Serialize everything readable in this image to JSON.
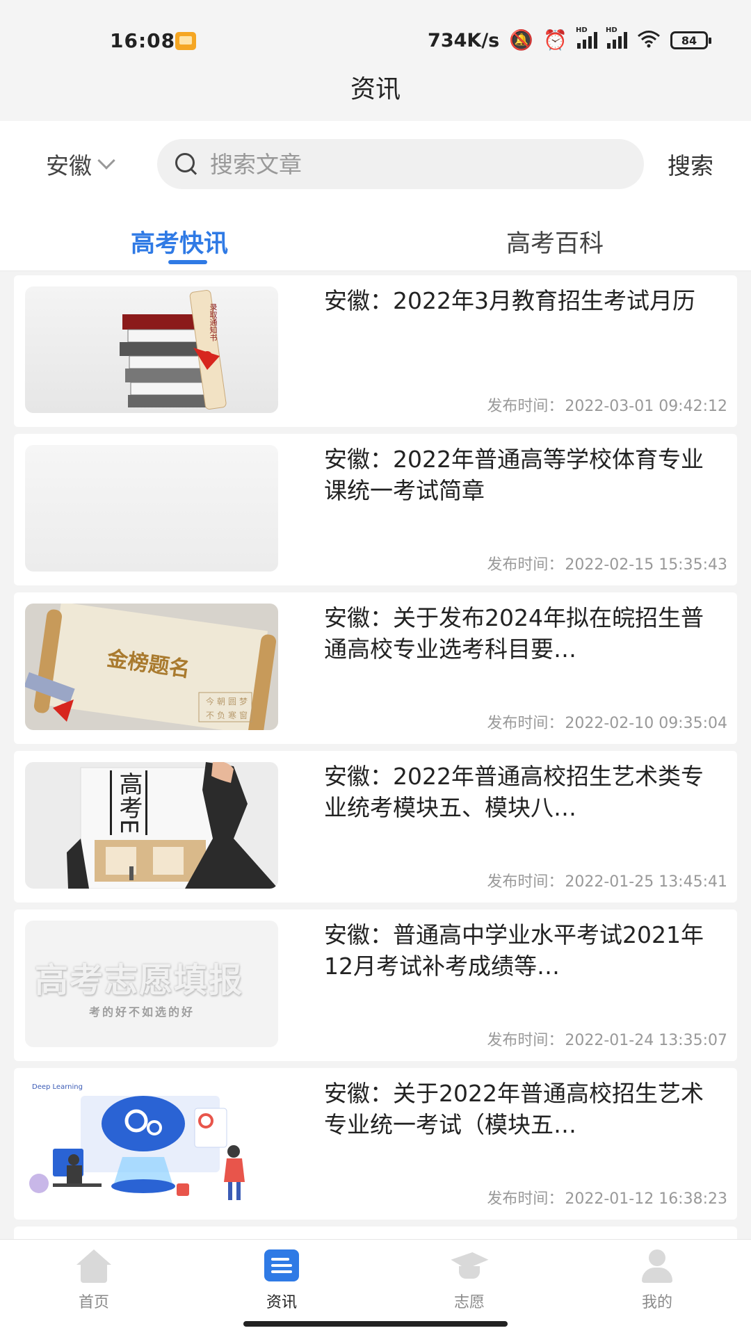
{
  "status_bar": {
    "time": "16:08",
    "network_speed": "734K/s",
    "battery": "84",
    "hd_label": "HD"
  },
  "header": {
    "title": "资讯"
  },
  "search": {
    "province": "安徽",
    "placeholder": "搜索文章",
    "value": "",
    "button_label": "搜索"
  },
  "tabs": [
    {
      "label": "高考快讯",
      "active": true
    },
    {
      "label": "高考百科",
      "active": false
    }
  ],
  "articles": [
    {
      "title": "安徽：2022年3月教育招生考试月历",
      "time_label": "发布时间：",
      "time": "2022-03-01 09:42:12",
      "thumbnail_text": "录取通知书"
    },
    {
      "title": "安徽：2022年普通高等学校体育专业课统一考试简章",
      "time_label": "发布时间：",
      "time": "2022-02-15 15:35:43"
    },
    {
      "title": "安徽：关于发布2024年拟在皖招生普通高校专业选考科目要…",
      "time_label": "发布时间：",
      "time": "2022-02-10 09:35:04",
      "thumbnail_text": "金榜题名",
      "thumbnail_subtext": [
        "今朝圆梦",
        "不负寒窗"
      ]
    },
    {
      "title": "安徽：2022年普通高校招生艺术类专业统考模块五、模块八…",
      "time_label": "发布时间：",
      "time": "2022-01-25 13:45:41",
      "thumbnail_text": "高考E"
    },
    {
      "title": "安徽：普通高中学业水平考试2021年12月考试补考成绩等…",
      "time_label": "发布时间：",
      "time": "2022-01-24 13:35:07",
      "thumbnail_text": "高考志愿填报",
      "thumbnail_subtext": [
        "考的好不如选的好"
      ]
    },
    {
      "title": "安徽：关于2022年普通高校招生艺术专业统一考试（模块五…",
      "time_label": "发布时间：",
      "time": "2022-01-12 16:38:23",
      "thumbnail_text": "Deep Learning"
    }
  ],
  "bottom_nav": [
    {
      "label": "首页",
      "icon": "home-icon",
      "active": false
    },
    {
      "label": "资讯",
      "icon": "news-icon",
      "active": true
    },
    {
      "label": "志愿",
      "icon": "graduation-cap-icon",
      "active": false
    },
    {
      "label": "我的",
      "icon": "user-icon",
      "active": false
    }
  ],
  "colors": {
    "accent": "#2f7ae5",
    "muted_text": "#999999",
    "background": "#f3f3f3"
  }
}
